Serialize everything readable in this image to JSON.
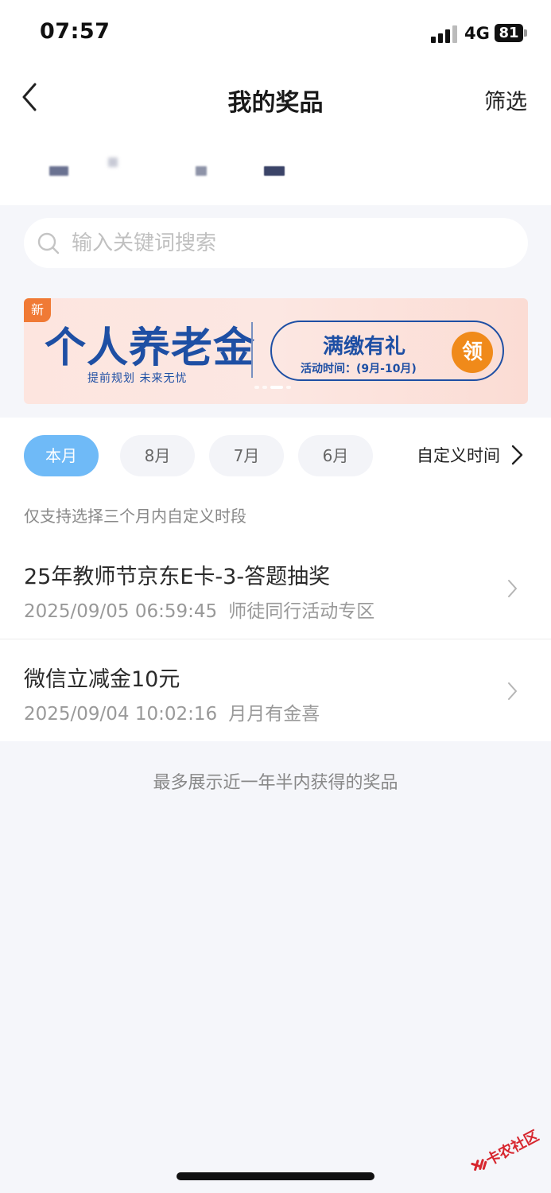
{
  "status_bar": {
    "time": "07:57",
    "network": "4G",
    "battery": "81"
  },
  "nav": {
    "title": "我的奖品",
    "filter_label": "筛选"
  },
  "search": {
    "placeholder": "输入关键词搜索"
  },
  "banner": {
    "badge": "新",
    "title": "个人养老金",
    "subtitle": "提前规划  未来无忧",
    "promo_title": "满缴有礼",
    "promo_sub": "活动时间：(9月-10月)",
    "claim_label": "领",
    "accent": "#1e4fa4",
    "button_color": "#f08a1a"
  },
  "months": [
    {
      "label": "本月",
      "active": true
    },
    {
      "label": "8月",
      "active": false
    },
    {
      "label": "7月",
      "active": false
    },
    {
      "label": "6月",
      "active": false
    }
  ],
  "custom_time_label": "自定义时间",
  "filter_note": "仅支持选择三个月内自定义时段",
  "prizes": [
    {
      "title": "25年教师节京东E卡-3-答题抽奖",
      "time": "2025/09/05 06:59:45",
      "source": "师徒同行活动专区"
    },
    {
      "title": "微信立减金10元",
      "time": "2025/09/04 10:02:16",
      "source": "月月有金喜"
    }
  ],
  "footer_note": "最多展示近一年半内获得的奖品",
  "watermark": "卡农社区",
  "colors": {
    "active_chip": "#6fbaf7",
    "page_bg": "#f5f6fa"
  }
}
